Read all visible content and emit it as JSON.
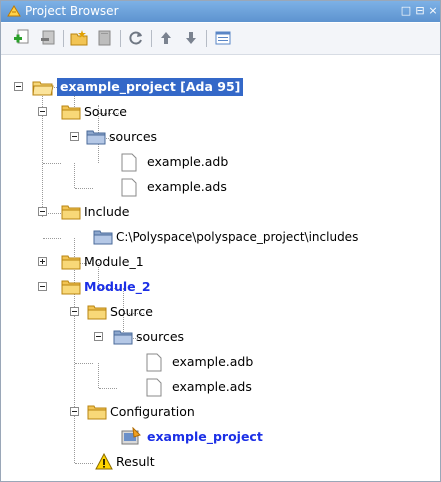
{
  "window": {
    "title": "Project Browser",
    "controls": [
      "□",
      "⊟",
      "×"
    ]
  },
  "toolbar": {
    "buttons": [
      {
        "name": "add-source-icon"
      },
      {
        "name": "remove-icon"
      },
      {
        "name": "new-folder-icon"
      },
      {
        "name": "page-icon"
      },
      {
        "name": "refresh-icon"
      },
      {
        "name": "move-up-icon"
      },
      {
        "name": "move-down-icon"
      },
      {
        "name": "properties-icon"
      }
    ]
  },
  "tree": {
    "project": "example_project [Ada 95]",
    "source": "Source",
    "sources": "sources",
    "file_adb": "example.adb",
    "file_ads": "example.ads",
    "include": "Include",
    "include_path": "C:\\Polyspace\\polyspace_project\\includes",
    "module1": "Module_1",
    "module2": "Module_2",
    "m2_source": "Source",
    "m2_sources": "sources",
    "m2_file_adb": "example.adb",
    "m2_file_ads": "example.ads",
    "configuration": "Configuration",
    "config_item": "example_project",
    "result": "Result"
  },
  "colors": {
    "titlebar": "#5d93cf",
    "selection": "#3468c8",
    "active_label": "#1b2fe6"
  }
}
